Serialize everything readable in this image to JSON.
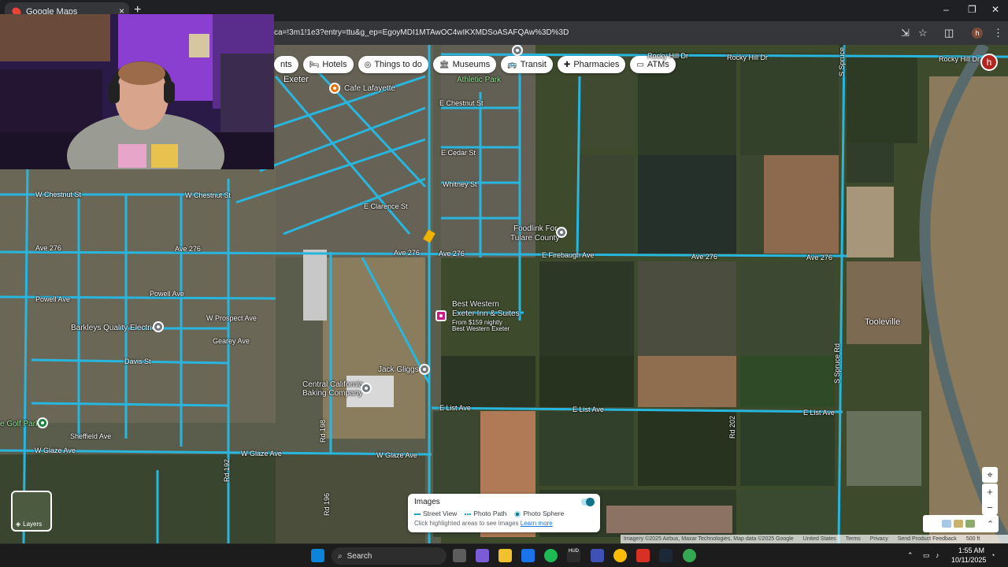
{
  "browser": {
    "tab_title": "Google Maps",
    "tab_close": "×",
    "new_tab": "+",
    "url": "ca=!3m1!1e3?entry=ttu&g_ep=EgoyMDI1MTAwOC4wIKXMDSoASAFQAw%3D%3D",
    "profile_initial": "h",
    "window": {
      "minimize": "–",
      "restore": "❐",
      "close": "✕"
    }
  },
  "map": {
    "chips": [
      {
        "icon": "",
        "label": "nts"
      },
      {
        "icon": "🛏",
        "label": "Hotels"
      },
      {
        "icon": "◎",
        "label": "Things to do"
      },
      {
        "icon": "🏛",
        "label": "Museums"
      },
      {
        "icon": "🚌",
        "label": "Transit"
      },
      {
        "icon": "✚",
        "label": "Pharmacies"
      },
      {
        "icon": "▭",
        "label": "ATMs"
      }
    ],
    "account_initial": "h",
    "places": {
      "exeter": "Exeter",
      "cafe": "Cafe Lafayette",
      "park": "Athletic Park",
      "foodlink": "Foodlink For",
      "foodlink2": "Tulare County",
      "bestwestern": "Best Western",
      "bestwestern2": "Exeter Inn & Suites",
      "bestwestern3": "From $159 nightly",
      "bestwestern4": "Best Western Exeter",
      "barkleys": "Barkleys Quality Electric",
      "jackgliggs": "Jack Gliggs",
      "centralca": "Central California",
      "centralca2": "Baking Company",
      "golf": "e Golf Park",
      "tooleville": "Tooleville"
    },
    "streets": {
      "rocky_hill_1": "Rocky Hill Dr",
      "rocky_hill_2": "Rocky Hill Dr",
      "rocky_hill_3": "Rocky Hill Dr",
      "chestnut_e": "E Chestnut St",
      "chestnut_w1": "W Chestnut St",
      "chestnut_w2": "W Chestnut St",
      "cedar": "E Cedar St",
      "whitney": "Whitney St",
      "clarence": "E Clarence St",
      "ave276_1": "Ave 276",
      "ave276_2": "Ave 276",
      "ave276_3": "Ave 276",
      "ave276_4": "Ave 276",
      "ave276_5": "Ave 276",
      "ave276_6": "Ave 276",
      "firebaugh": "E Firebaugh Ave",
      "powell_1": "Powell Ave",
      "powell_2": "Powell Ave",
      "prospect": "W Prospect Ave",
      "gearey": "Gearey Ave",
      "davis": "Davis St",
      "sheffield": "Sheffield Ave",
      "glaze_1": "W Glaze Ave",
      "glaze_2": "W Glaze Ave",
      "list_1": "E List Ave",
      "list_2": "E List Ave",
      "list_3": "E List Ave",
      "spruce_1": "S Spruce Rd",
      "spruce_2": "S Spruce Rd",
      "rd202": "Rd 202",
      "rd196": "Rd 196",
      "rd198": "Rd 198",
      "rd192": "Rd 192"
    },
    "layers_label": "Layers",
    "legend": {
      "title": "Images",
      "street_view": "Street View",
      "photo_path": "Photo Path",
      "photo_sphere": "Photo Sphere",
      "hint": "Click highlighted areas to see images",
      "learn_more": "Learn more"
    },
    "controls": {
      "locate": "⌖",
      "zoom_in": "+",
      "zoom_out": "−",
      "expand": "⌃"
    },
    "footer": {
      "imagery": "Imagery ©2025 Airbus, Maxar Technologies, Map data ©2025 Google",
      "country": "United States",
      "terms": "Terms",
      "privacy": "Privacy",
      "feedback": "Send Product Feedback",
      "scale": "500 ft"
    }
  },
  "taskbar": {
    "search_label": "Search",
    "time": "1:55 AM",
    "date": "10/11/2025",
    "hud_label": "HUD"
  }
}
